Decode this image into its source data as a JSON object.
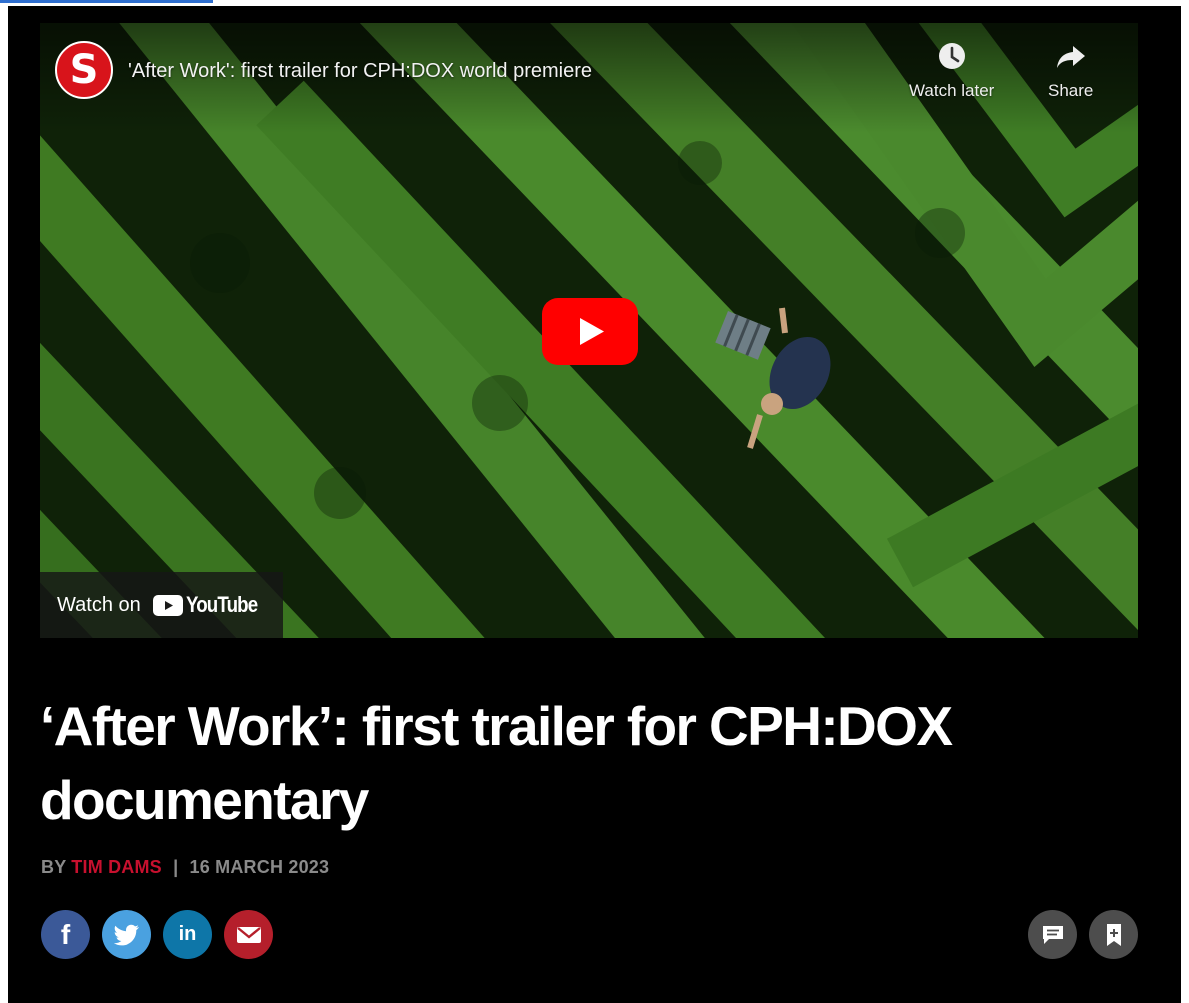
{
  "video": {
    "channel_logo_letter": "S",
    "title": "'After Work': first trailer for CPH:DOX world premiere",
    "watch_later_label": "Watch later",
    "share_label": "Share",
    "watch_on_label": "Watch on",
    "youtube_wordmark": "YouTube"
  },
  "article": {
    "headline_line1": "‘After Work’: first trailer for CPH:DOX",
    "headline_line2": "documentary",
    "by_label": "BY",
    "author": "TIM DAMS",
    "separator": "|",
    "date": "16 MARCH 2023"
  },
  "social": {
    "facebook_glyph": "f",
    "linkedin_glyph": "in"
  },
  "colors": {
    "accent_red": "#c8102e",
    "youtube_red": "#ff0000",
    "facebook": "#3b5998",
    "twitter": "#4aa1e0",
    "linkedin": "#0e76a8",
    "email": "#b51f2b"
  }
}
